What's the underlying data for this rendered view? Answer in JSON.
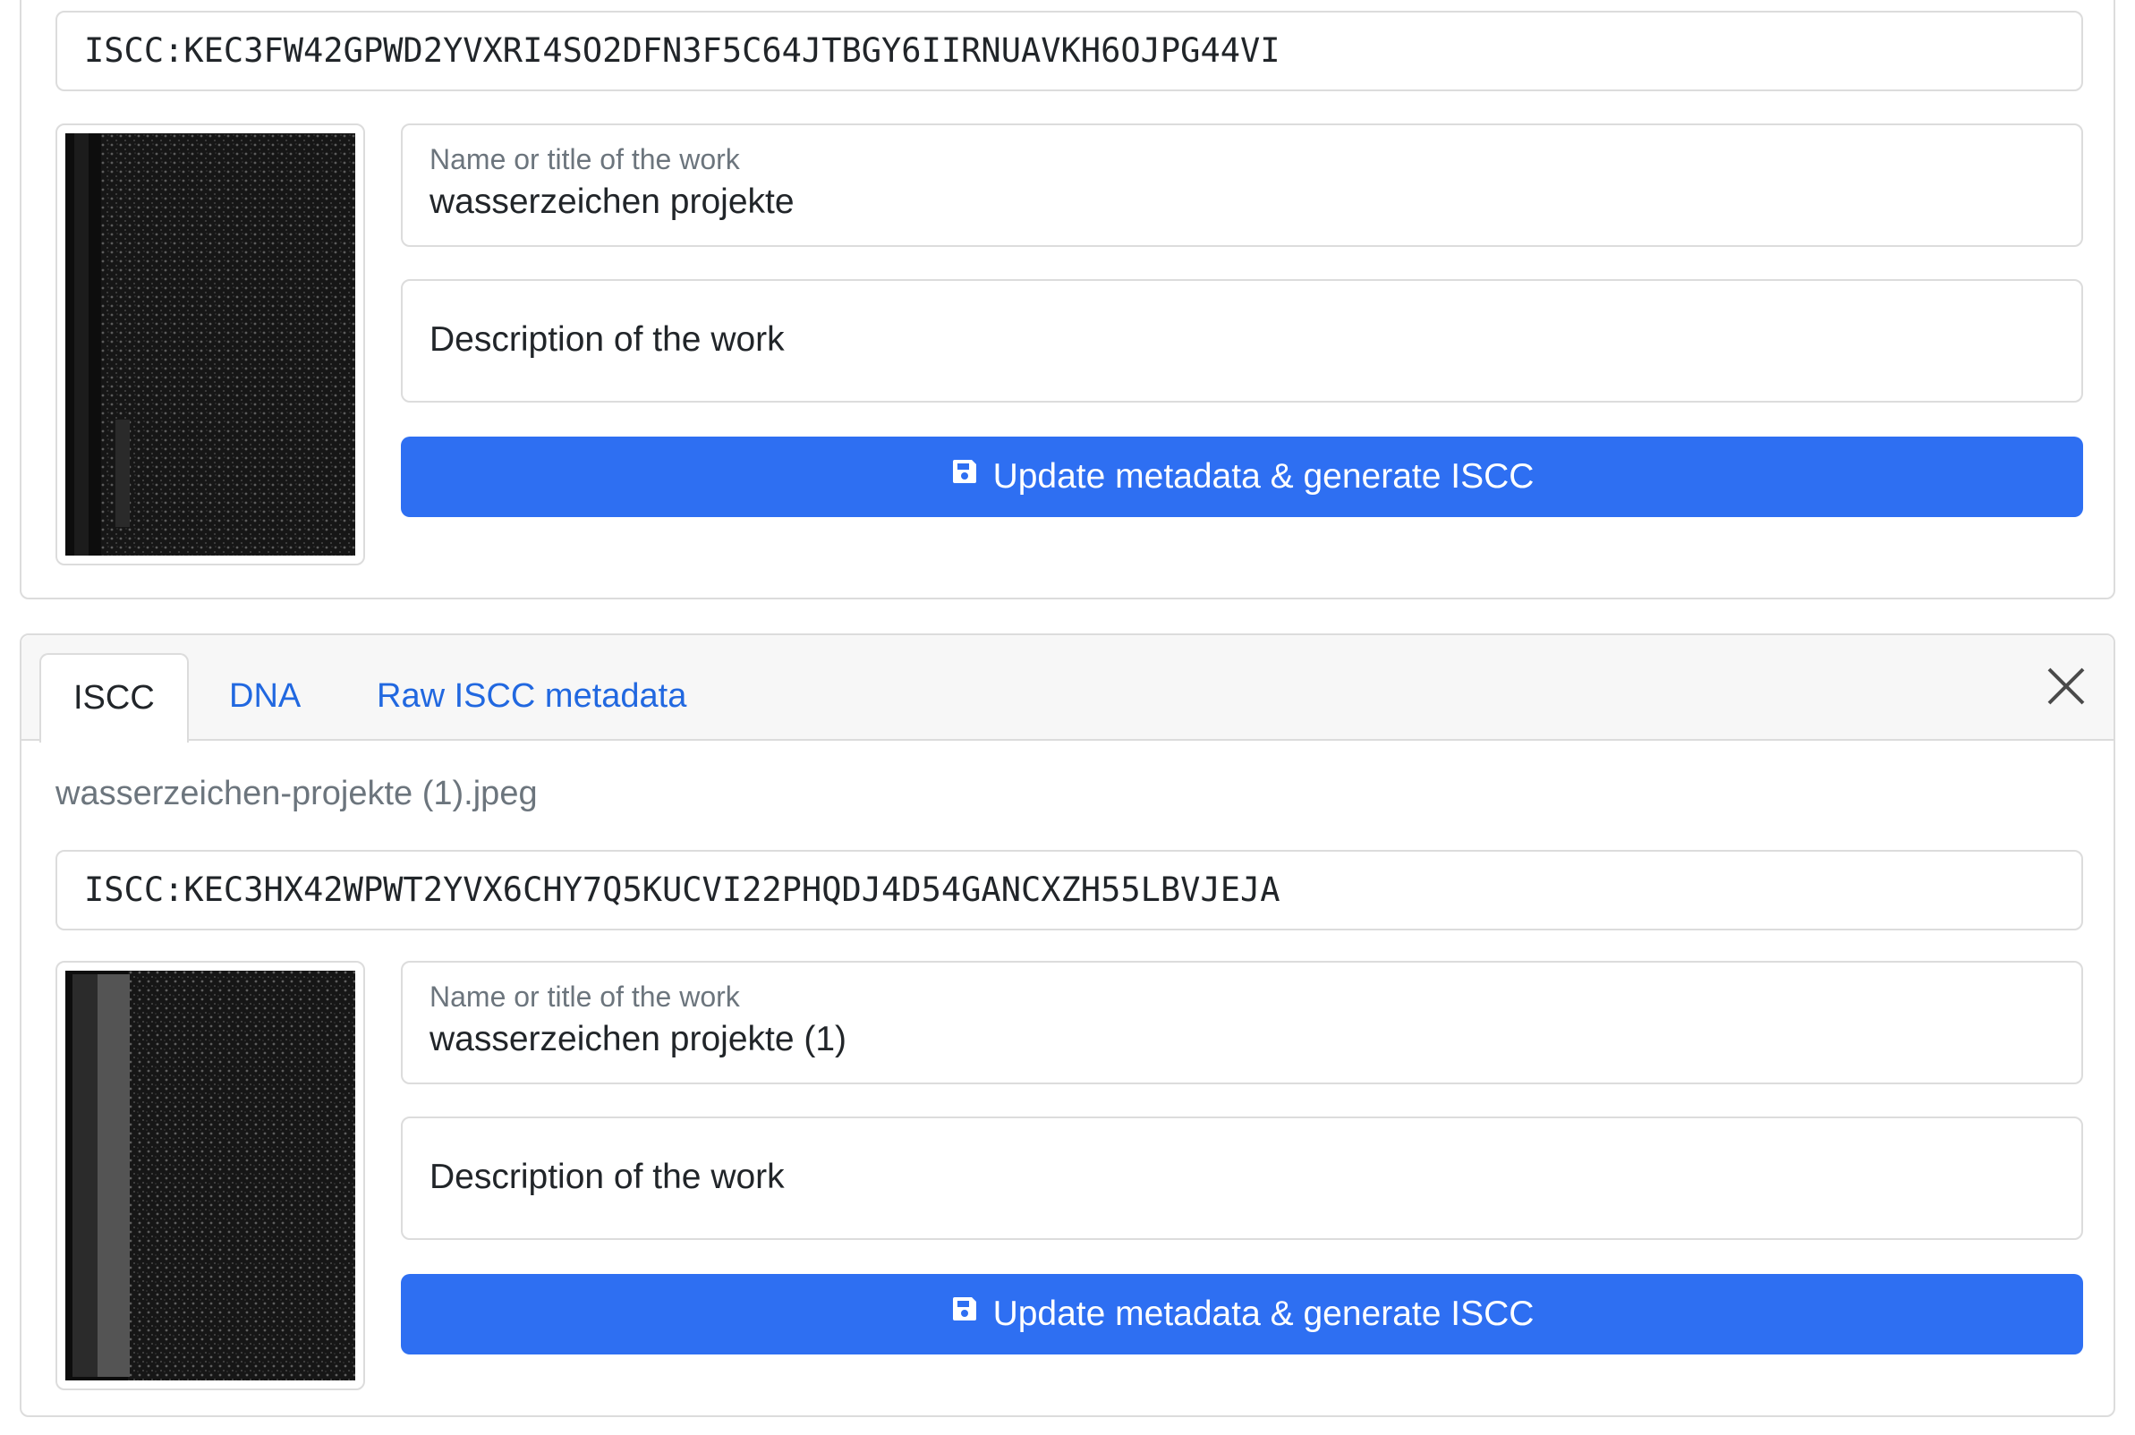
{
  "cards": [
    {
      "iscc_code": "ISCC:KEC3FW42GPWD2YVXRI4SO2DFN3F5C64JTBGY6IIRNUAVKH6OJPG44VI",
      "name_label": "Name or title of the work",
      "name_value": "wasserzeichen projekte",
      "description_placeholder": "Description of the work",
      "button_label": "Update metadata & generate ISCC",
      "button_icon": "save-icon"
    },
    {
      "tabs": [
        {
          "label": "ISCC",
          "active": true
        },
        {
          "label": "DNA",
          "active": false
        },
        {
          "label": "Raw ISCC metadata",
          "active": false
        }
      ],
      "close_icon": "close-icon",
      "filename": "wasserzeichen-projekte (1).jpeg",
      "iscc_code": "ISCC:KEC3HX42WPWT2YVX6CHY7Q5KUCVI22PHQDJ4D54GANCXZH55LBVJEJA",
      "name_label": "Name or title of the work",
      "name_value": "wasserzeichen projekte (1)",
      "description_placeholder": "Description of the work",
      "button_label": "Update metadata & generate ISCC",
      "button_icon": "save-icon"
    }
  ],
  "colors": {
    "primary": "#2e6ff2",
    "link": "#2168e0",
    "border": "#dcdcdc",
    "muted": "#6c757d"
  }
}
